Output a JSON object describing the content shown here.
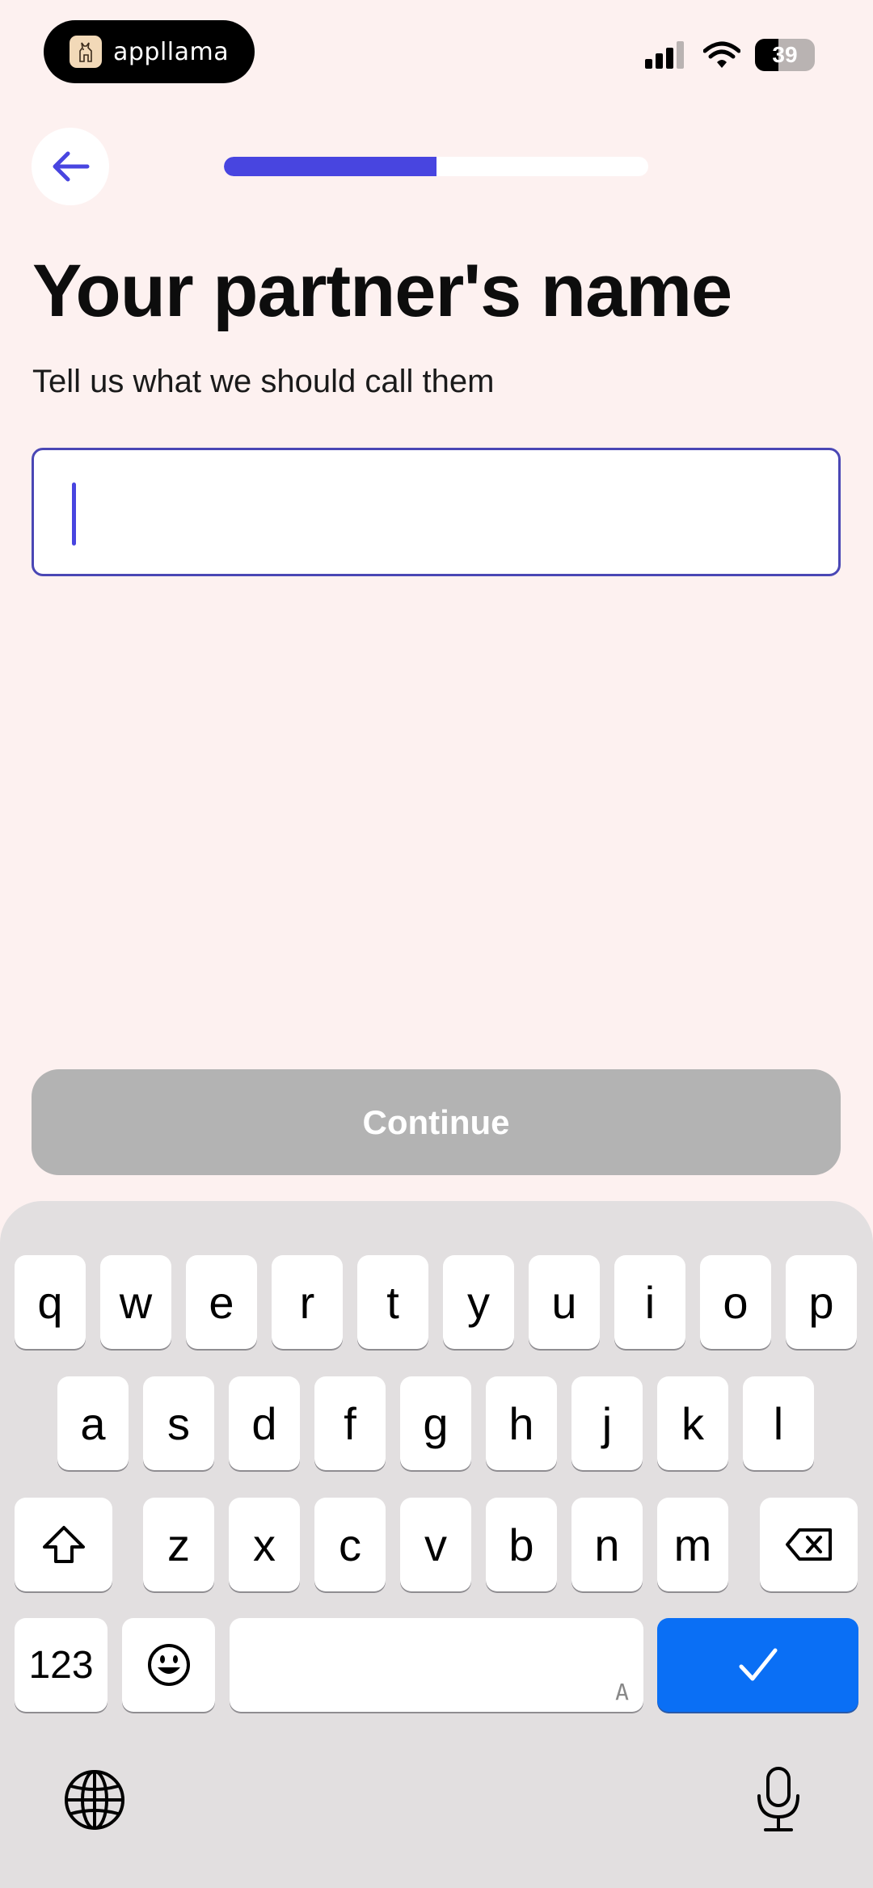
{
  "status_bar": {
    "app_name": "appllama",
    "battery_level": "39",
    "battery_fraction": 0.39
  },
  "nav": {
    "back_icon": "arrow-left-icon",
    "progress_fraction": 0.5
  },
  "title": "Your partner's name",
  "subtitle": "Tell us what we should call them",
  "name_input": {
    "value": "",
    "placeholder": ""
  },
  "continue_label": "Continue",
  "keyboard": {
    "row1": [
      "q",
      "w",
      "e",
      "r",
      "t",
      "y",
      "u",
      "i",
      "o",
      "p"
    ],
    "row2": [
      "a",
      "s",
      "d",
      "f",
      "g",
      "h",
      "j",
      "k",
      "l"
    ],
    "row3": [
      "z",
      "x",
      "c",
      "v",
      "b",
      "n",
      "m"
    ],
    "numbers_label": "123",
    "space_corner_label": "A",
    "icons": {
      "shift": "shift-icon",
      "delete": "backspace-icon",
      "emoji": "emoji-icon",
      "done": "checkmark-icon",
      "globe": "globe-icon",
      "mic": "microphone-icon"
    }
  },
  "colors": {
    "background": "#fdf1f0",
    "accent": "#4845e0",
    "button_disabled": "#b3b3b3",
    "keyboard_done": "#0a6ff5"
  }
}
